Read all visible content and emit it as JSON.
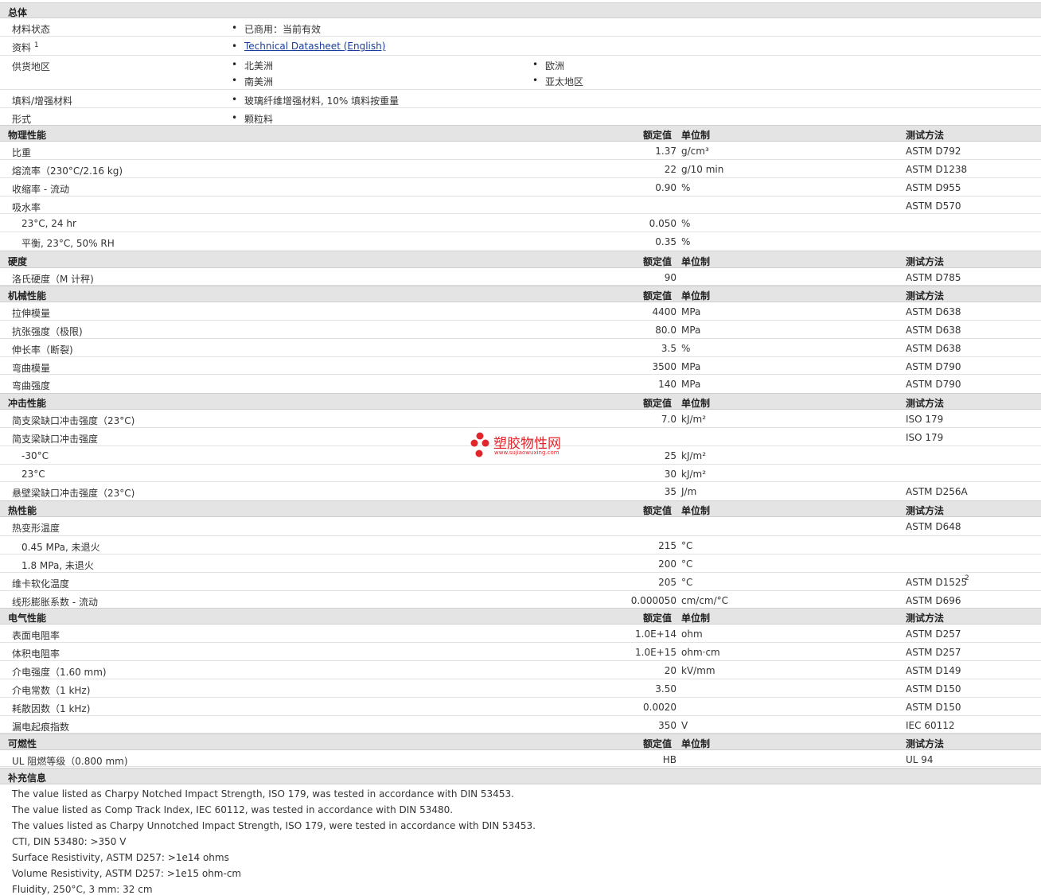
{
  "general": {
    "title": "总体",
    "status_label": "材料状态",
    "status_value": "已商用：当前有效",
    "docs_label": "资料",
    "docs_sup": "1",
    "docs_link": "Technical Datasheet (English)",
    "supply_label": "供货地区",
    "supply_regions": [
      "北美洲",
      "欧洲",
      "南美洲",
      "亚太地区"
    ],
    "filler_label": "填料/增强材料",
    "filler_value": "玻璃纤维增强材料, 10% 填料按重量",
    "form_label": "形式",
    "form_value": "颗粒料"
  },
  "col_headers": {
    "value": "额定值",
    "unit": "单位制",
    "method": "测试方法"
  },
  "sections": {
    "physical": {
      "title": "物理性能",
      "rows": [
        {
          "name": "比重",
          "value": "1.37",
          "unit": "g/cm³",
          "method": "ASTM D792"
        },
        {
          "name": "熔流率（230°C/2.16 kg)",
          "value": "22",
          "unit": "g/10 min",
          "method": "ASTM D1238"
        },
        {
          "name": "收缩率 - 流动",
          "value": "0.90",
          "unit": "%",
          "method": "ASTM D955"
        },
        {
          "name": "吸水率",
          "value": "",
          "unit": "",
          "method": "ASTM D570"
        },
        {
          "name": "23°C, 24 hr",
          "value": "0.050",
          "unit": "%",
          "method": ""
        },
        {
          "name": "平衡, 23°C, 50% RH",
          "value": "0.35",
          "unit": "%",
          "method": ""
        }
      ]
    },
    "hardness": {
      "title": "硬度",
      "rows": [
        {
          "name": "洛氏硬度（M 计秤)",
          "value": "90",
          "unit": "",
          "method": "ASTM D785"
        }
      ]
    },
    "mechanical": {
      "title": "机械性能",
      "rows": [
        {
          "name": "拉伸模量",
          "value": "4400",
          "unit": "MPa",
          "method": "ASTM D638"
        },
        {
          "name": "抗张强度（极限)",
          "value": "80.0",
          "unit": "MPa",
          "method": "ASTM D638"
        },
        {
          "name": "伸长率（断裂)",
          "value": "3.5",
          "unit": "%",
          "method": "ASTM D638"
        },
        {
          "name": "弯曲模量",
          "value": "3500",
          "unit": "MPa",
          "method": "ASTM D790"
        },
        {
          "name": "弯曲强度",
          "value": "140",
          "unit": "MPa",
          "method": "ASTM D790"
        }
      ]
    },
    "impact": {
      "title": "冲击性能",
      "rows": [
        {
          "name": "简支梁缺口冲击强度（23°C)",
          "value": "7.0",
          "unit": "kJ/m²",
          "method": "ISO 179"
        },
        {
          "name": "简支梁缺口冲击强度",
          "value": "",
          "unit": "",
          "method": "ISO 179"
        },
        {
          "name": "-30°C",
          "value": "25",
          "unit": "kJ/m²",
          "method": ""
        },
        {
          "name": "23°C",
          "value": "30",
          "unit": "kJ/m²",
          "method": ""
        },
        {
          "name": "悬壁梁缺口冲击强度（23°C)",
          "value": "35",
          "unit": "J/m",
          "method": "ASTM D256A"
        }
      ]
    },
    "thermal": {
      "title": "热性能",
      "rows": [
        {
          "name": "热变形温度",
          "value": "",
          "unit": "",
          "method": "ASTM D648"
        },
        {
          "name": "0.45 MPa, 未退火",
          "value": "215",
          "unit": "°C",
          "method": ""
        },
        {
          "name": "1.8 MPa, 未退火",
          "value": "200",
          "unit": "°C",
          "method": ""
        },
        {
          "name": "维卡软化温度",
          "value": "205",
          "unit": "°C",
          "method": "ASTM D1525",
          "method_sup": "2"
        },
        {
          "name": "线形膨胀系数 - 流动",
          "value": "0.000050",
          "unit": "cm/cm/°C",
          "method": "ASTM D696"
        }
      ]
    },
    "electrical": {
      "title": "电气性能",
      "rows": [
        {
          "name": "表面电阻率",
          "value": "1.0E+14",
          "unit": "ohm",
          "method": "ASTM D257"
        },
        {
          "name": "体积电阻率",
          "value": "1.0E+15",
          "unit": "ohm·cm",
          "method": "ASTM D257"
        },
        {
          "name": "介电强度（1.60 mm)",
          "value": "20",
          "unit": "kV/mm",
          "method": "ASTM D149"
        },
        {
          "name": "介电常数（1 kHz)",
          "value": "3.50",
          "unit": "",
          "method": "ASTM D150"
        },
        {
          "name": "耗散因数（1 kHz)",
          "value": "0.0020",
          "unit": "",
          "method": "ASTM D150"
        },
        {
          "name": "漏电起痕指数",
          "value": "350",
          "unit": "V",
          "method": "IEC 60112"
        }
      ]
    },
    "flammability": {
      "title": "可燃性",
      "rows": [
        {
          "name": "UL 阻燃等级（0.800 mm)",
          "value": "HB",
          "unit": "",
          "method": "UL 94"
        }
      ]
    }
  },
  "supplement": {
    "title": "补充信息",
    "notes": [
      "The value listed as Charpy Notched Impact Strength, ISO 179, was tested in accordance with DIN 53453.",
      "The value listed as Comp Track Index, IEC 60112, was tested in accordance with DIN 53480.",
      "The values listed as Charpy Unnotched Impact Strength, ISO 179, were tested in accordance with DIN 53453.",
      "CTI, DIN 53480: >350 V",
      "Surface Resistivity, ASTM D257: >1e14 ohms",
      "Volume Resistivity, ASTM D257: >1e15 ohm-cm",
      "Fluidity, 250°C, 3 mm: 32 cm"
    ]
  },
  "watermark": {
    "text": "塑胶物性网",
    "url": "www.sujiaowuxing.com"
  },
  "colors": {
    "header_bg": "#e4e4e4",
    "link": "#1a3c9c",
    "watermark": "#e0262c"
  }
}
